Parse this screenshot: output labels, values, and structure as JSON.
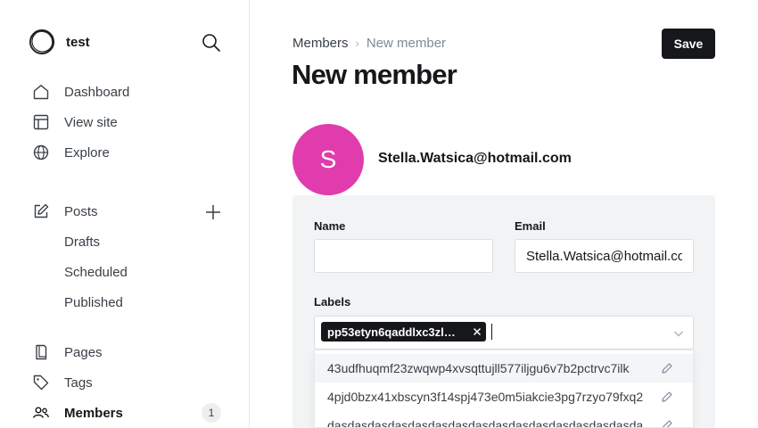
{
  "sidebar": {
    "site_title": "test",
    "nav": {
      "dashboard": "Dashboard",
      "view_site": "View site",
      "explore": "Explore",
      "posts": "Posts",
      "drafts": "Drafts",
      "scheduled": "Scheduled",
      "published": "Published",
      "pages": "Pages",
      "tags": "Tags",
      "members": "Members",
      "members_count": "1"
    }
  },
  "header": {
    "breadcrumb_parent": "Members",
    "breadcrumb_separator": "›",
    "breadcrumb_current": "New member",
    "title": "New member",
    "save_label": "Save"
  },
  "member": {
    "avatar_initial": "S",
    "avatar_color": "#e13cad",
    "email_display": "Stella.Watsica@hotmail.com"
  },
  "form": {
    "name_label": "Name",
    "name_value": "",
    "email_label": "Email",
    "email_value": "Stella.Watsica@hotmail.com",
    "labels_label": "Labels",
    "selected_label": "pp53etyn6qaddlxc3zl…",
    "options": [
      "43udfhuqmf23zwqwp4xvsqttujll577iljgu6v7b2pctrvc7ilk",
      "4pjd0bzx41xbscyn3f14spj473e0m5iakcie3pg7rzyo79fxq2",
      "dasdasdasdasdasdasdasdasdasdasdasdasdasdasdasdasdas"
    ]
  },
  "icons": {
    "logo": "ring-logo-icon",
    "search": "search-icon",
    "dashboard": "home-icon",
    "view_site": "layout-icon",
    "explore": "globe-icon",
    "posts": "edit-icon",
    "add": "plus-icon",
    "pages": "page-icon",
    "tags": "tag-icon",
    "members": "members-icon",
    "remove": "close-icon",
    "dropdown": "chevron-down-icon",
    "option_edit": "pencil-icon"
  }
}
